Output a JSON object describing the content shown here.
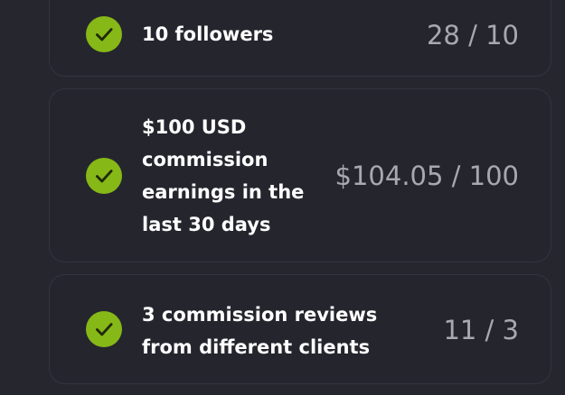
{
  "milestones": [
    {
      "label": "10 followers",
      "progress": "28 / 10",
      "status_icon": "check-circle-icon",
      "accent": "#86b817"
    },
    {
      "label": "$100 USD commission earnings in the last 30 days",
      "progress": "$104.05 / 100",
      "status_icon": "check-circle-icon",
      "accent": "#86b817"
    },
    {
      "label": "3 commission reviews from different clients",
      "progress": "11 / 3",
      "status_icon": "check-circle-icon",
      "accent": "#86b817"
    }
  ]
}
